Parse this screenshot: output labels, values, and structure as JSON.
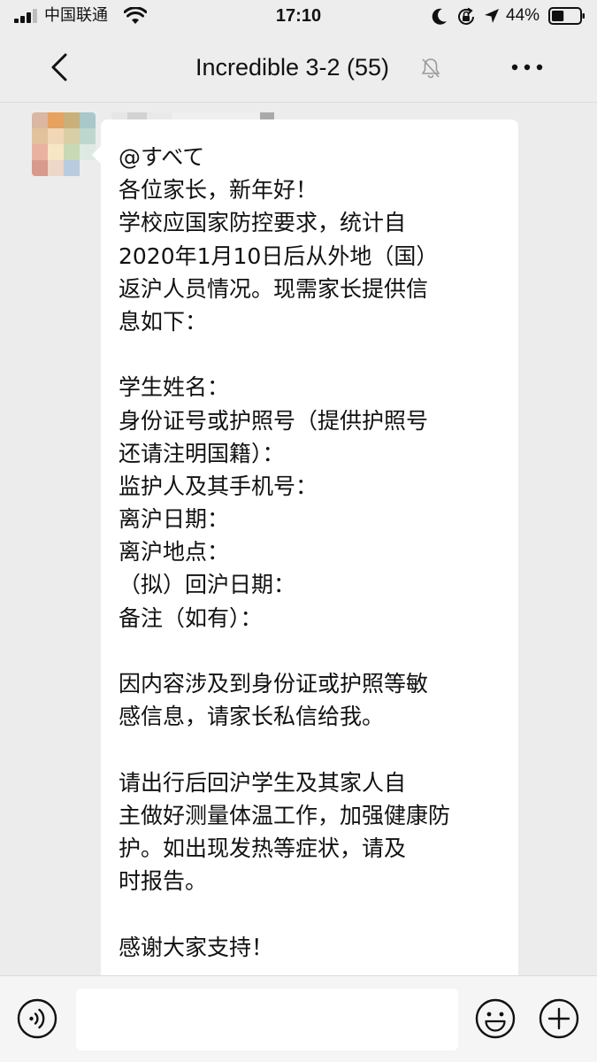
{
  "status_bar": {
    "carrier": "中国联通",
    "time": "17:10",
    "battery_percent": "44%",
    "battery_level": 0.44,
    "icons": [
      "signal-icon",
      "wifi-icon",
      "moon-icon",
      "lock-rotation-icon",
      "location-icon",
      "battery-icon"
    ]
  },
  "nav": {
    "title": "Incredible 3-2 (55)",
    "icons": [
      "back-icon",
      "mute-icon",
      "more-icon"
    ]
  },
  "message": {
    "lines": [
      "@すべて",
      "各位家长，新年好！",
      "学校应国家防控要求，统计自",
      "2020年1月10日后从外地（国）",
      "返沪人员情况。现需家长提供信",
      "息如下：",
      "",
      "学生姓名：",
      "身份证号或护照号（提供护照号",
      "还请注明国籍）：",
      "监护人及其手机号：",
      "离沪日期：",
      "离沪地点：",
      "（拟）回沪日期：",
      "备注（如有）：",
      "",
      "因内容涉及到身份证或护照等敏",
      "感信息，请家长私信给我。",
      "",
      "请出行后回沪学生及其家人自",
      "主做好测量体温工作，加强健康防",
      "护。如出现发热等症状，请及",
      "时报告。",
      "",
      "感谢大家支持！"
    ]
  },
  "colors": {
    "chat_background": "#ececec",
    "bubble": "#ffffff",
    "bar_background": "#ededed",
    "text": "#111111"
  },
  "input_bar": {
    "input_value": "",
    "icons": [
      "voice-icon",
      "emoji-icon",
      "plus-icon"
    ]
  }
}
